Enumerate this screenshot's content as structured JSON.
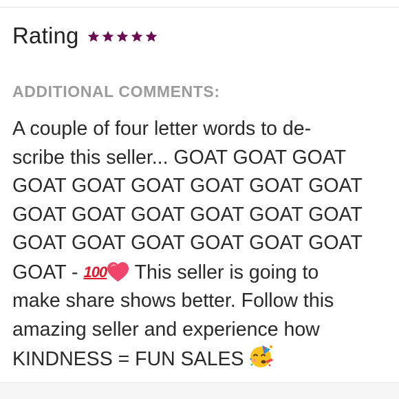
{
  "rating": {
    "label": "Rating",
    "stars_filled": 5,
    "stars_total": 5,
    "star_color": "#6b0a52"
  },
  "comments": {
    "heading": "ADDITIONAL COMMENTS:",
    "lines": [
      "A couple of four letter words to de-",
      "scribe this seller... GOAT GOAT GOAT",
      "GOAT GOAT GOAT GOAT GOAT GOAT",
      "GOAT GOAT GOAT GOAT GOAT GOAT",
      "GOAT GOAT GOAT GOAT GOAT GOAT",
      "GOAT - ",
      "This seller is going to",
      "make share shows better. Follow this",
      "amazing seller and experience how",
      "KINDNESS = FUN SALES "
    ],
    "hundred_emoji": "100",
    "emojis": [
      "hundred-points-icon",
      "red-heart-icon",
      "partying-face-icon"
    ]
  },
  "colors": {
    "text": "#2a2a2a",
    "heading": "#9b9b9b",
    "divider": "#e4e4e4"
  }
}
